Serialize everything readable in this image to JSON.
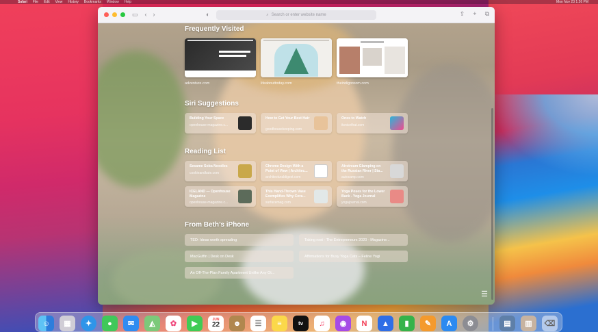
{
  "menubar": {
    "apple": "",
    "app": "Safari",
    "items": [
      "File",
      "Edit",
      "View",
      "History",
      "Bookmarks",
      "Window",
      "Help"
    ],
    "right": "Mon Nov 23  1:26 PM"
  },
  "toolbar": {
    "url_placeholder": "Search or enter website name"
  },
  "start_page": {
    "frequently_visited": {
      "title": "Frequently Visited",
      "items": [
        {
          "label": "adventure.com"
        },
        {
          "label": "lifeabouttoday.com"
        },
        {
          "label": "theindigoroom.com"
        }
      ]
    },
    "siri_suggestions": {
      "title": "Siri Suggestions",
      "items": [
        {
          "title": "Building Your Space",
          "source": "openhouse-magazine.c..."
        },
        {
          "title": "How to Get Your Best Hair",
          "source": "goodhousekeeping.com"
        },
        {
          "title": "Ones to Watch",
          "source": "itsnicethat.com"
        }
      ]
    },
    "reading_list": {
      "title": "Reading List",
      "items": [
        {
          "title": "Sesame Soba Noodles",
          "source": "cookieandkate.com"
        },
        {
          "title": "Chrome Design With a Point of View | Architec...",
          "source": "architecturaldigest.com"
        },
        {
          "title": "Airstream Glamping on the Russian River | Sta...",
          "source": "autocamp.com"
        },
        {
          "title": "ICELAND — Openhouse Magazine",
          "source": "openhouse-magazine.c..."
        },
        {
          "title": "This Hand-Thrown Vase Exemplifies Why Cera...",
          "source": "surfacemag.com"
        },
        {
          "title": "Yoga Poses for the Lower Back - Yoga Journal",
          "source": "yogajournal.com"
        }
      ]
    },
    "from_iphone": {
      "title": "From Beth’s iPhone",
      "items": [
        "TED: Ideas worth spreading",
        "Taking root - The Entrepreneurs 2020 - Magazine...",
        "MacGuffin | Desk on Desk",
        "Affirmations for Busy Yoga Cats – Feline Yogi",
        "An Off-The-Plan Family Apartment Unlike Any Ot..."
      ]
    }
  },
  "dock": {
    "apps": [
      "Finder",
      "Launchpad",
      "Safari",
      "Messages",
      "Mail",
      "Maps",
      "Photos",
      "FaceTime",
      "Calendar",
      "Contacts",
      "Reminders",
      "Notes",
      "TV",
      "Music",
      "Podcasts",
      "News",
      "Keynote",
      "Numbers",
      "Pages",
      "App Store",
      "System Preferences"
    ],
    "calendar_month": "JUN",
    "calendar_day": "22",
    "tv_label": "tv"
  },
  "colors": {
    "accent_red": "#ff5f57",
    "accent_yellow": "#febc2e",
    "accent_green": "#28c840"
  }
}
